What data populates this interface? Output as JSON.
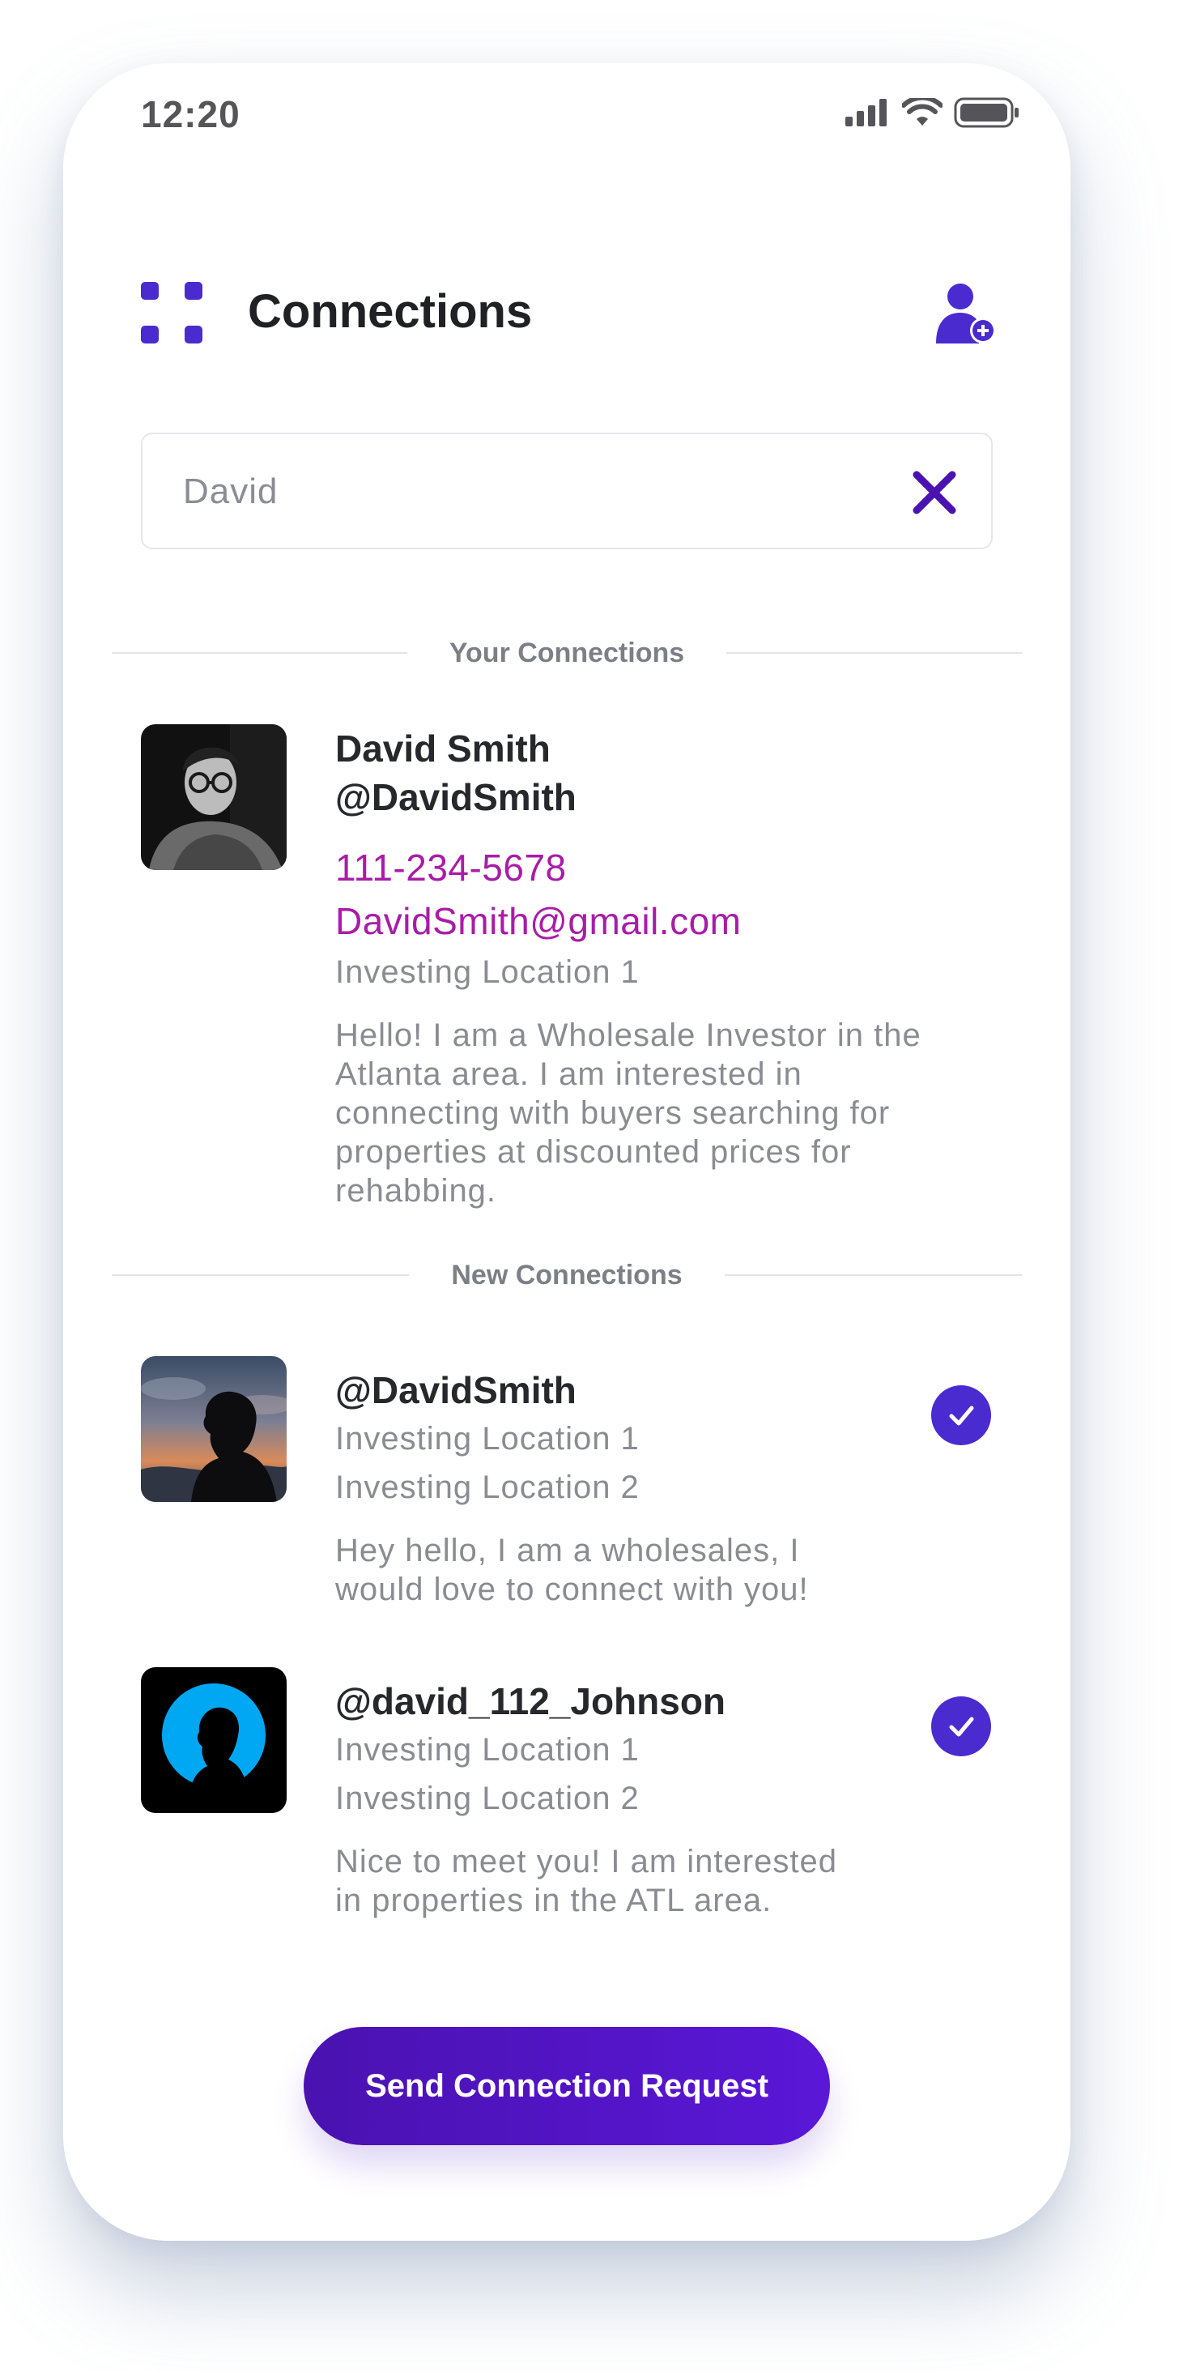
{
  "status_bar": {
    "time": "12:20",
    "icons": [
      "cellular-signal-icon",
      "wifi-icon",
      "battery-icon"
    ]
  },
  "header": {
    "title": "Connections",
    "menu_icon": "grid-menu-icon",
    "action_icon": "add-user-icon"
  },
  "search": {
    "value": "David",
    "clear_icon": "close-icon"
  },
  "your_connections": {
    "section_label": "Your Connections",
    "items": [
      {
        "name": "David Smith",
        "handle": "@DavidSmith",
        "phone": "111-234-5678",
        "email": "DavidSmith@gmail.com",
        "location": "Investing Location 1",
        "bio_lines": [
          "Hello! I am a Wholesale Investor in the",
          "Atlanta area. I am interested in",
          "connecting with buyers searching for",
          "properties at discounted prices for",
          "rehabbing."
        ]
      }
    ]
  },
  "new_connections": {
    "section_label": "New Connections",
    "items": [
      {
        "handle": "@DavidSmith",
        "locations": [
          "Investing Location 1",
          "Investing Location 2"
        ],
        "bio_lines": [
          "Hey hello, I am a wholesales, I",
          "would love to connect with you!"
        ],
        "selected": true
      },
      {
        "handle": "@david_112_Johnson",
        "locations": [
          "Investing Location 1",
          "Investing Location 2"
        ],
        "bio_lines": [
          "Nice to meet you! I am interested",
          "in properties in the ATL area."
        ],
        "selected": true
      }
    ]
  },
  "cta": {
    "label": "Send Connection Request"
  },
  "colors": {
    "accent": "#4a2bcf",
    "contact_link": "#a81ca8",
    "cta_gradient_start": "#4a12b0",
    "cta_gradient_end": "#5a17d8"
  }
}
